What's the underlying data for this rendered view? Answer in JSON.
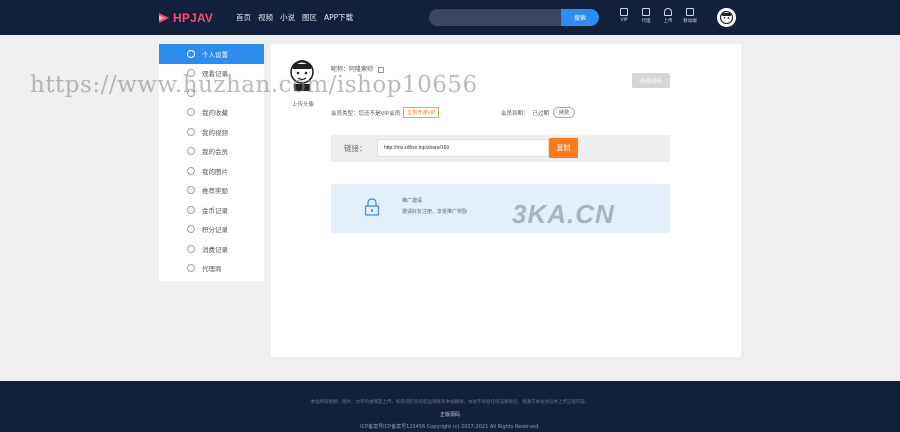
{
  "brand": {
    "logo_text": "HPJAV",
    "logo_color": "#ff4a6b"
  },
  "nav": [
    "首页",
    "视频",
    "小说",
    "图区",
    "APP下载"
  ],
  "search": {
    "placeholder": "",
    "button": "搜索"
  },
  "top_icons": [
    {
      "icon": "vip-icon",
      "label": "VIP"
    },
    {
      "icon": "agent-icon",
      "label": "代理"
    },
    {
      "icon": "upload-icon",
      "label": "上传"
    },
    {
      "icon": "qrcode-icon",
      "label": "移动端"
    }
  ],
  "sidebar": {
    "items": [
      {
        "label": "个人设置",
        "icon": "user-icon",
        "active": true
      },
      {
        "label": "观看记录",
        "icon": "history-icon"
      },
      {
        "label": "",
        "icon": "menu-icon"
      },
      {
        "label": "我的收藏",
        "icon": "star-icon"
      },
      {
        "label": "我的视频",
        "icon": "video-icon"
      },
      {
        "label": "我的会员",
        "icon": "vip-card-icon"
      },
      {
        "label": "我的图片",
        "icon": "image-icon"
      },
      {
        "label": "推荐奖励",
        "icon": "gift-icon"
      },
      {
        "label": "金币记录",
        "icon": "coin-icon"
      },
      {
        "label": "积分记录",
        "icon": "points-icon"
      },
      {
        "label": "消费记录",
        "icon": "receipt-icon"
      },
      {
        "label": "代理商",
        "icon": "agent-icon"
      }
    ]
  },
  "profile": {
    "upload_avatar": "上传头像",
    "nickname_line": "昵称：阿隆索帅",
    "mid_line": "",
    "mid_line_b": "",
    "member_type": "会员类型：您还不是VIP会员",
    "open_vip": "立刻开通VIP",
    "expire": "会员到期：",
    "expire_value": "已过期",
    "renew": "续费",
    "edit_button": "修改资料"
  },
  "share": {
    "label": "链接：",
    "url": "http://mv.xdhxx.top/share/160",
    "copy_button": "复制"
  },
  "invite": {
    "title": "推广邀请",
    "desc": "邀请好友注册，享受推广奖励"
  },
  "footer": {
    "line1": "本站所有视频、图片、文字均由网友上传，如有侵犯您的权益请联系本站删除，本站不承担任何法律责任，请遵守本站协议并上传正规内容。",
    "line2": "正版源码",
    "line3": "ICP备案号ICP备案号123456  Copyright (c) 2017-2021 All Rights Reserved."
  },
  "watermarks": {
    "url": "https://www.huzhan.com/ishop10656",
    "brand": "3KA.CN"
  },
  "colors": {
    "header_bg": "#13203c",
    "accent": "#2d8cf0",
    "orange": "#ff7a1a"
  }
}
